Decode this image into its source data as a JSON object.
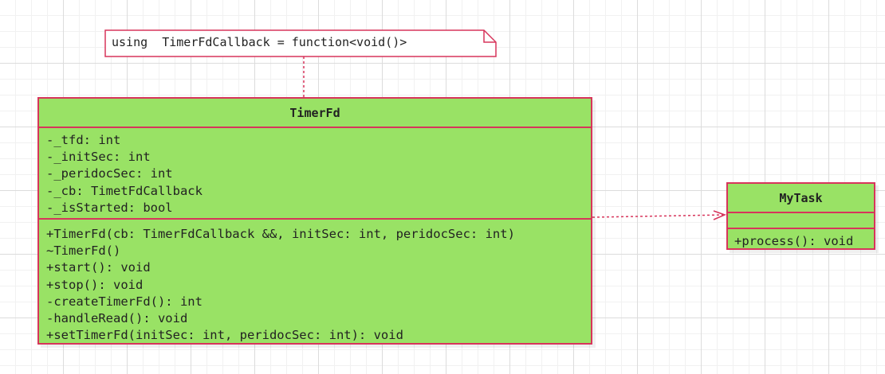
{
  "note": {
    "text": "using  TimerFdCallback = function<void()>"
  },
  "classes": {
    "timerfd": {
      "name": "TimerFd",
      "attributes": [
        "-_tfd: int",
        "-_initSec: int",
        "-_peridocSec: int",
        "-_cb: TimetFdCallback",
        "-_isStarted: bool"
      ],
      "methods": [
        "+TimerFd(cb: TimerFdCallback &&, initSec: int, peridocSec: int)",
        "~TimerFd()",
        "+start(): void",
        "+stop(): void",
        "-createTimerFd(): int",
        "-handleRead(): void",
        "+setTimerFd(initSec: int, peridocSec: int): void"
      ]
    },
    "mytask": {
      "name": "MyTask",
      "attributes": [],
      "methods": [
        "+process(): void"
      ]
    }
  },
  "relations": [
    {
      "from": "note",
      "to": "timerfd",
      "kind": "note-anchor"
    },
    {
      "from": "timerfd",
      "to": "mytask",
      "kind": "dependency"
    }
  ],
  "colors": {
    "class_fill": "#99e265",
    "class_border": "#d7355b",
    "connector": "#d7355b",
    "note_border": "#d7355b",
    "text": "#222222",
    "grid": "#dcdcdc"
  }
}
